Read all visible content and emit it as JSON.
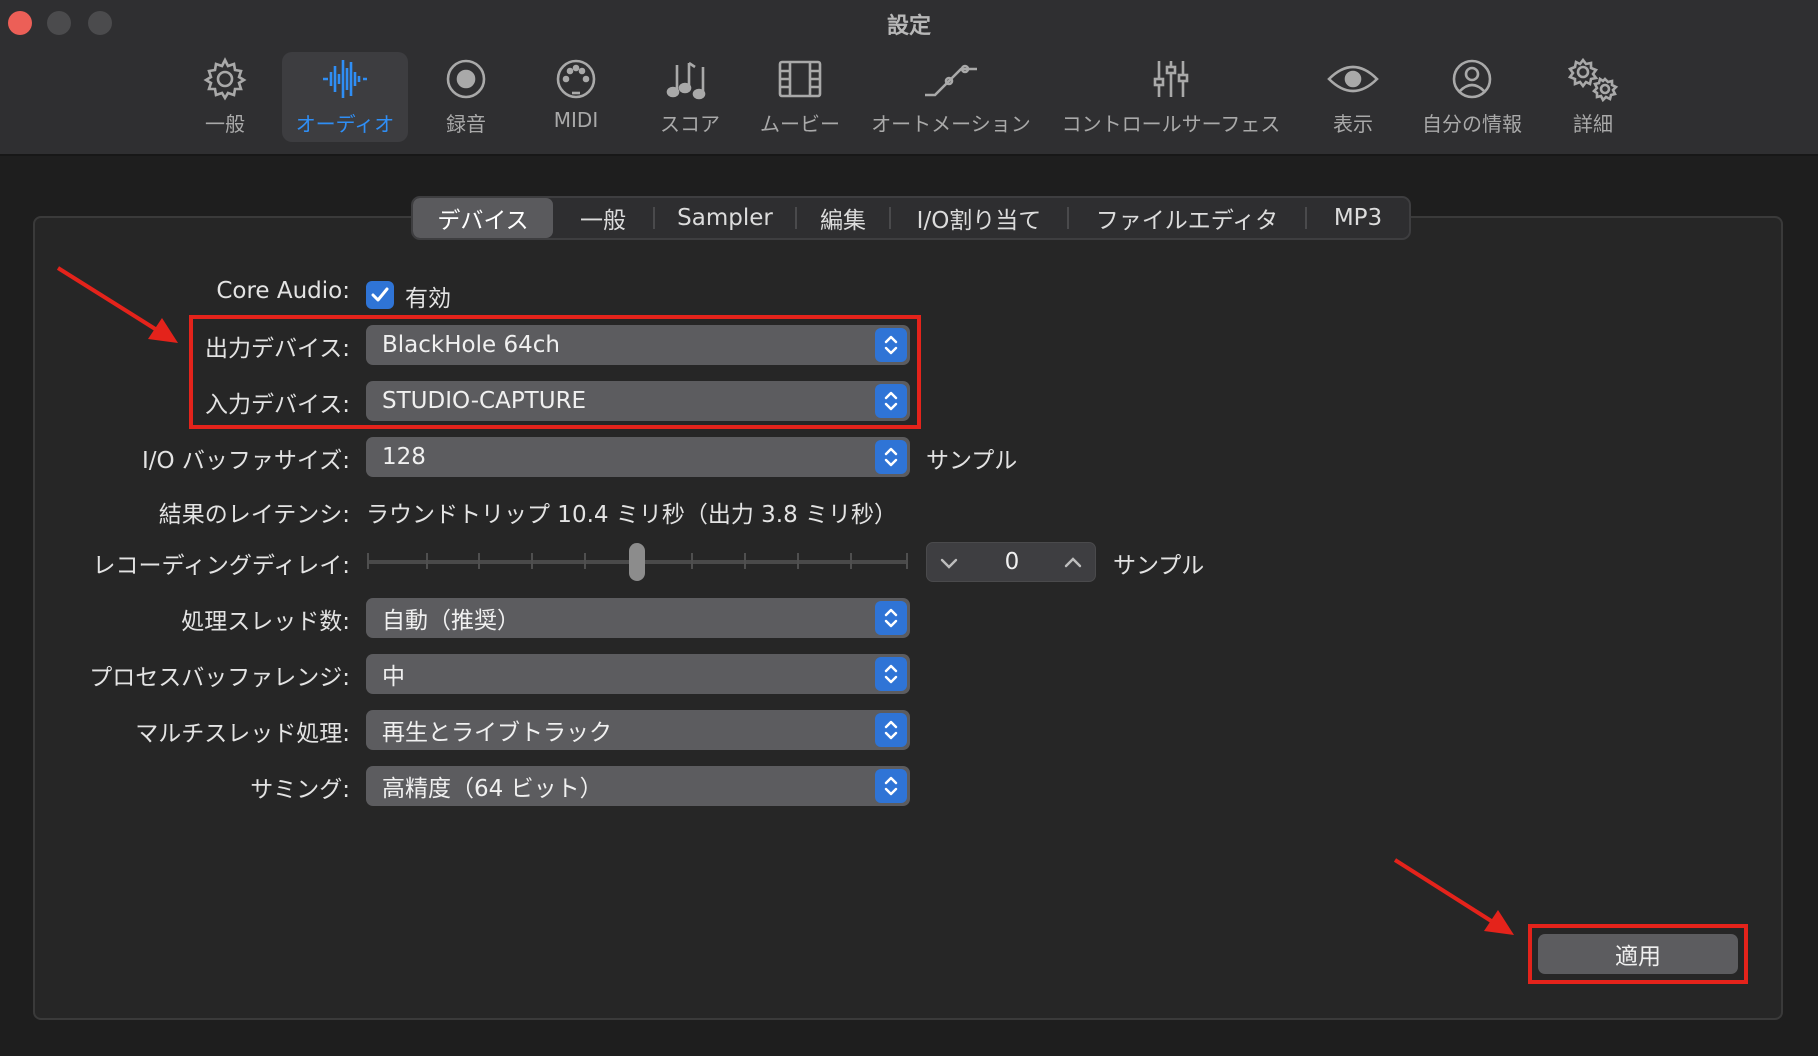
{
  "window": {
    "title": "設定"
  },
  "toolbar": [
    {
      "label": "一般",
      "icon": "gear-icon"
    },
    {
      "label": "オーディオ",
      "icon": "waveform-icon"
    },
    {
      "label": "録音",
      "icon": "record-icon"
    },
    {
      "label": "MIDI",
      "icon": "midi-port-icon"
    },
    {
      "label": "スコア",
      "icon": "music-notes-icon"
    },
    {
      "label": "ムービー",
      "icon": "film-icon"
    },
    {
      "label": "オートメーション",
      "icon": "automation-curve-icon"
    },
    {
      "label": "コントロールサーフェス",
      "icon": "sliders-icon"
    },
    {
      "label": "表示",
      "icon": "eye-icon"
    },
    {
      "label": "自分の情報",
      "icon": "person-circle-icon"
    },
    {
      "label": "詳細",
      "icon": "gears-icon"
    }
  ],
  "tabs": [
    "デバイス",
    "一般",
    "Sampler",
    "編集",
    "I/O割り当て",
    "ファイルエディタ",
    "MP3"
  ],
  "form": {
    "core_audio_label": "Core Audio:",
    "core_audio_value": "有効",
    "output_label": "出力デバイス:",
    "output_value": "BlackHole 64ch",
    "input_label": "入力デバイス:",
    "input_value": "STUDIO-CAPTURE",
    "buffer_label": "I/O バッファサイズ:",
    "buffer_value": "128",
    "buffer_unit": "サンプル",
    "latency_label": "結果のレイテンシ:",
    "latency_value": "ラウンドトリップ 10.4 ミリ秒（出力 3.8 ミリ秒）",
    "delay_label": "レコーディングディレイ:",
    "delay_value": "0",
    "delay_unit": "サンプル",
    "threads_label": "処理スレッド数:",
    "threads_value": "自動（推奨）",
    "range_label": "プロセスバッファレンジ:",
    "range_value": "中",
    "multithread_label": "マルチスレッド処理:",
    "multithread_value": "再生とライブトラック",
    "summing_label": "サミング:",
    "summing_value": "高精度（64 ビット）"
  },
  "apply_label": "適用",
  "colors": {
    "accent": "#2f8ef5",
    "highlight": "#e4231b"
  }
}
